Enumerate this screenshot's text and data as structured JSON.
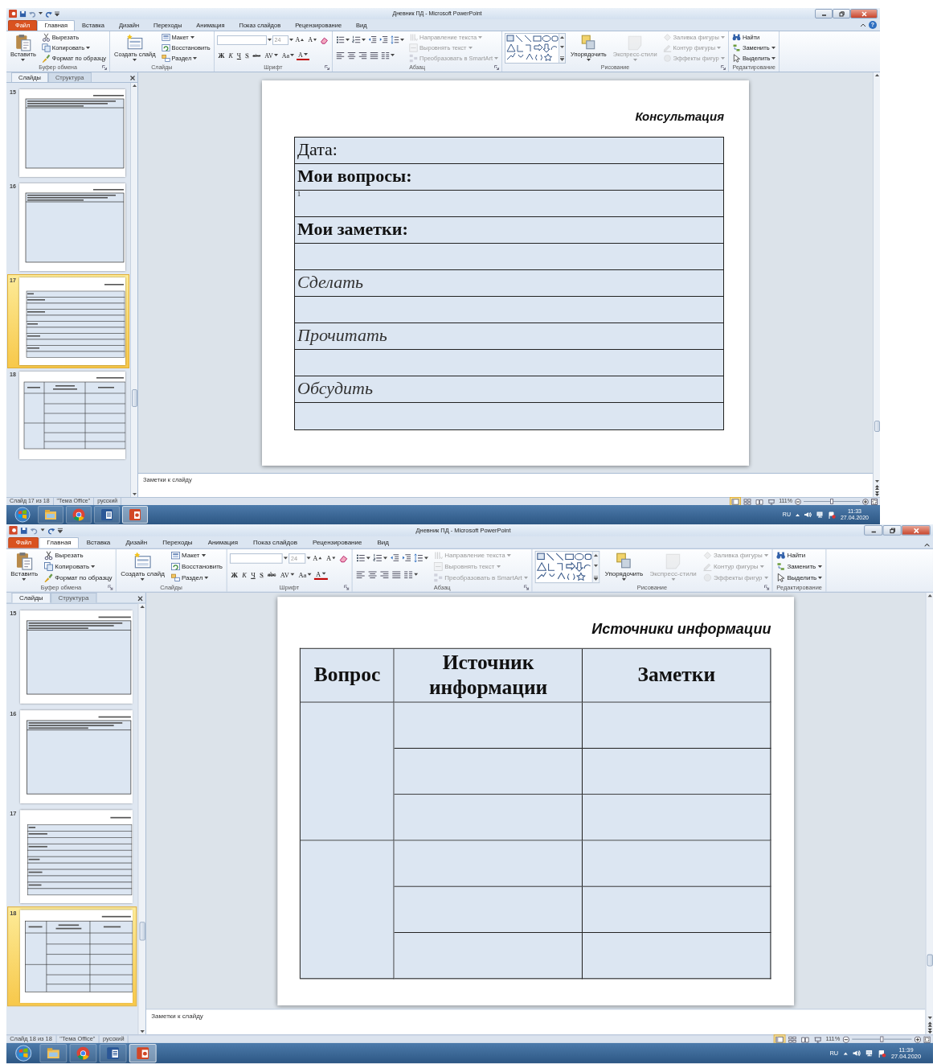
{
  "windows": [
    {
      "title": "Дневник ПД - Microsoft PowerPoint",
      "tabs": [
        {
          "label": "Файл",
          "kind": "file",
          "selected": false
        },
        {
          "label": "Главная",
          "kind": "tab",
          "selected": true
        },
        {
          "label": "Вставка",
          "kind": "tab",
          "selected": false
        },
        {
          "label": "Дизайн",
          "kind": "tab",
          "selected": false
        },
        {
          "label": "Переходы",
          "kind": "tab",
          "selected": false
        },
        {
          "label": "Анимация",
          "kind": "tab",
          "selected": false
        },
        {
          "label": "Показ слайдов",
          "kind": "tab",
          "selected": false
        },
        {
          "label": "Рецензирование",
          "kind": "tab",
          "selected": false
        },
        {
          "label": "Вид",
          "kind": "tab",
          "selected": false
        }
      ],
      "help": "?",
      "ribbon": [
        {
          "label": "Буфер обмена",
          "launcher": true,
          "columns": [
            [
              [
                {
                  "kind": "large",
                  "label": "Вставить",
                  "dropdown": true,
                  "disabled": false
                }
              ]
            ],
            [
              [
                {
                  "kind": "small",
                  "label": "Вырезать",
                  "dropdown": false,
                  "disabled": false
                }
              ],
              [
                {
                  "kind": "small",
                  "label": "Копировать",
                  "dropdown": true,
                  "disabled": false
                }
              ],
              [
                {
                  "kind": "small",
                  "label": "Формат по образцу",
                  "dropdown": false,
                  "disabled": false
                }
              ]
            ]
          ]
        },
        {
          "label": "Слайды",
          "launcher": false,
          "columns": [
            [
              [
                {
                  "kind": "large",
                  "label": "Создать слайд",
                  "dropdown": true,
                  "disabled": false
                }
              ]
            ],
            [
              [
                {
                  "kind": "small",
                  "label": "Макет",
                  "dropdown": true,
                  "disabled": false
                }
              ],
              [
                {
                  "kind": "small",
                  "label": "Восстановить",
                  "dropdown": false,
                  "disabled": false
                }
              ],
              [
                {
                  "kind": "small",
                  "label": "Раздел",
                  "dropdown": true,
                  "disabled": false
                }
              ]
            ]
          ]
        },
        {
          "label": "Шрифт",
          "launcher": true,
          "columns": [
            [
              [
                {
                  "kind": "fontname",
                  "dropdown": true,
                  "disabled": true
                },
                {
                  "kind": "fontsize",
                  "value": "24",
                  "dropdown": true,
                  "disabled": true
                },
                {
                  "kind": "glyph",
                  "text": "A",
                  "dropdown": false,
                  "disabled": false
                },
                {
                  "kind": "glyph",
                  "text": "A",
                  "dropdown": false,
                  "disabled": false
                },
                {
                  "kind": "tool",
                  "dropdown": false,
                  "disabled": false
                }
              ],
              [
                {
                  "kind": "glyph",
                  "text": "Ж",
                  "dropdown": false,
                  "disabled": false
                },
                {
                  "kind": "glyph",
                  "text": "К",
                  "dropdown": false,
                  "disabled": false
                },
                {
                  "kind": "glyph",
                  "text": "Ч",
                  "dropdown": false,
                  "disabled": false
                },
                {
                  "kind": "glyph",
                  "text": "S",
                  "dropdown": false,
                  "disabled": false
                },
                {
                  "kind": "glyph",
                  "text": "abc",
                  "dropdown": false,
                  "disabled": false
                },
                {
                  "kind": "glyph",
                  "text": "AV",
                  "dropdown": true,
                  "disabled": false
                },
                {
                  "kind": "glyph",
                  "text": "Aa",
                  "dropdown": true,
                  "disabled": false
                },
                {
                  "kind": "glyph",
                  "text": "A",
                  "dropdown": true,
                  "disabled": false
                }
              ]
            ]
          ]
        },
        {
          "label": "Абзац",
          "launcher": true,
          "columns": [
            [
              [
                {
                  "kind": "tool",
                  "dropdown": true,
                  "disabled": false
                },
                {
                  "kind": "tool",
                  "dropdown": true,
                  "disabled": false
                },
                {
                  "kind": "tool",
                  "dropdown": false,
                  "disabled": false
                },
                {
                  "kind": "tool",
                  "dropdown": false,
                  "disabled": false
                },
                {
                  "kind": "tool",
                  "dropdown": true,
                  "disabled": false
                }
              ],
              [
                {
                  "kind": "tool",
                  "dropdown": false,
                  "disabled": false
                },
                {
                  "kind": "tool",
                  "dropdown": false,
                  "disabled": false
                },
                {
                  "kind": "tool",
                  "dropdown": false,
                  "disabled": false
                },
                {
                  "kind": "tool",
                  "dropdown": false,
                  "disabled": false
                },
                {
                  "kind": "tool",
                  "dropdown": true,
                  "disabled": false
                }
              ]
            ],
            [
              [
                {
                  "kind": "small",
                  "label": "Направление текста",
                  "dropdown": true,
                  "disabled": true
                }
              ],
              [
                {
                  "kind": "small",
                  "label": "Выровнять текст",
                  "dropdown": true,
                  "disabled": true
                }
              ],
              [
                {
                  "kind": "small",
                  "label": "Преобразовать в SmartArt",
                  "dropdown": true,
                  "disabled": true
                }
              ]
            ]
          ]
        },
        {
          "label": "Рисование",
          "launcher": true,
          "columns": [
            [
              [
                {
                  "kind": "gallery",
                  "dropdown": true,
                  "disabled": false
                }
              ]
            ],
            [
              [
                {
                  "kind": "large",
                  "label": "Упорядочить",
                  "dropdown": true,
                  "disabled": false
                }
              ]
            ],
            [
              [
                {
                  "kind": "large",
                  "label": "Экспресс-стили",
                  "dropdown": true,
                  "disabled": true
                }
              ]
            ],
            [
              [
                {
                  "kind": "small",
                  "label": "Заливка фигуры",
                  "dropdown": true,
                  "disabled": true
                }
              ],
              [
                {
                  "kind": "small",
                  "label": "Контур фигуры",
                  "dropdown": true,
                  "disabled": true
                }
              ],
              [
                {
                  "kind": "small",
                  "label": "Эффекты фигур",
                  "dropdown": true,
                  "disabled": true
                }
              ]
            ]
          ]
        },
        {
          "label": "Редактирование",
          "launcher": false,
          "columns": [
            [
              [
                {
                  "kind": "small",
                  "label": "Найти",
                  "dropdown": false,
                  "disabled": false
                }
              ],
              [
                {
                  "kind": "small",
                  "label": "Заменить",
                  "dropdown": true,
                  "disabled": false
                }
              ],
              [
                {
                  "kind": "small",
                  "label": "Выделить",
                  "dropdown": true,
                  "disabled": false
                }
              ]
            ]
          ]
        }
      ],
      "pane_tabs": [
        {
          "label": "Слайды",
          "selected": true
        },
        {
          "label": "Структура",
          "selected": false
        }
      ],
      "thumbnails": [
        {
          "number": "15",
          "selected": false,
          "kind": "question"
        },
        {
          "number": "16",
          "selected": false,
          "kind": "question"
        },
        {
          "number": "17",
          "selected": true,
          "kind": "form"
        },
        {
          "number": "18",
          "selected": false,
          "kind": "grid"
        }
      ],
      "slide": {
        "kind": "form",
        "title": "Консультация",
        "rows": [
          {
            "text": "Дата:",
            "kind": "plain"
          },
          {
            "text": "Мои вопросы:",
            "kind": "bold"
          },
          {
            "text": "1",
            "kind": "note"
          },
          {
            "text": "Мои заметки:",
            "kind": "bold"
          },
          {
            "kind": "blank"
          },
          {
            "text": "Сделать",
            "kind": "italic"
          },
          {
            "kind": "blank"
          },
          {
            "text": "Прочитать",
            "kind": "italic"
          },
          {
            "kind": "blank"
          },
          {
            "text": "Обсудить",
            "kind": "italic"
          },
          {
            "kind": "blank"
          }
        ]
      },
      "notes": {
        "placeholder": "Заметки к слайду"
      },
      "status": [
        "Слайд 17 из 18",
        "\"Тема Office\"",
        "русский"
      ],
      "views": [
        {
          "selected": true
        },
        {
          "selected": false
        },
        {
          "selected": false
        },
        {
          "selected": false
        }
      ],
      "zoom": {
        "reading": "111%",
        "level": 0.5
      },
      "taskbar": {
        "apps": [
          {
            "kind": "folder",
            "selected": false
          },
          {
            "kind": "browser",
            "selected": false
          },
          {
            "kind": "writer",
            "selected": false
          },
          {
            "kind": "slides",
            "selected": true
          }
        ],
        "language": "RU",
        "time": "11:33",
        "date": "27.04.2020"
      }
    },
    {
      "title": "Дневник ПД - Microsoft PowerPoint",
      "tabs": [
        {
          "label": "Файл",
          "kind": "file",
          "selected": false
        },
        {
          "label": "Главная",
          "kind": "tab",
          "selected": true
        },
        {
          "label": "Вставка",
          "kind": "tab",
          "selected": false
        },
        {
          "label": "Дизайн",
          "kind": "tab",
          "selected": false
        },
        {
          "label": "Переходы",
          "kind": "tab",
          "selected": false
        },
        {
          "label": "Анимация",
          "kind": "tab",
          "selected": false
        },
        {
          "label": "Показ слайдов",
          "kind": "tab",
          "selected": false
        },
        {
          "label": "Рецензирование",
          "kind": "tab",
          "selected": false
        },
        {
          "label": "Вид",
          "kind": "tab",
          "selected": false
        }
      ],
      "ribbon": [
        {
          "label": "Буфер обмена",
          "launcher": true,
          "columns": [
            [
              [
                {
                  "kind": "large",
                  "label": "Вставить",
                  "dropdown": true,
                  "disabled": false
                }
              ]
            ],
            [
              [
                {
                  "kind": "small",
                  "label": "Вырезать",
                  "dropdown": false,
                  "disabled": false
                }
              ],
              [
                {
                  "kind": "small",
                  "label": "Копировать",
                  "dropdown": true,
                  "disabled": false
                }
              ],
              [
                {
                  "kind": "small",
                  "label": "Формат по образцу",
                  "dropdown": false,
                  "disabled": false
                }
              ]
            ]
          ]
        },
        {
          "label": "Слайды",
          "launcher": false,
          "columns": [
            [
              [
                {
                  "kind": "large",
                  "label": "Создать слайд",
                  "dropdown": true,
                  "disabled": false
                }
              ]
            ],
            [
              [
                {
                  "kind": "small",
                  "label": "Макет",
                  "dropdown": true,
                  "disabled": false
                }
              ],
              [
                {
                  "kind": "small",
                  "label": "Восстановить",
                  "dropdown": false,
                  "disabled": false
                }
              ],
              [
                {
                  "kind": "small",
                  "label": "Раздел",
                  "dropdown": true,
                  "disabled": false
                }
              ]
            ]
          ]
        },
        {
          "label": "Шрифт",
          "launcher": true,
          "columns": [
            [
              [
                {
                  "kind": "fontname",
                  "dropdown": true,
                  "disabled": true
                },
                {
                  "kind": "fontsize",
                  "value": "24",
                  "dropdown": true,
                  "disabled": true
                },
                {
                  "kind": "glyph",
                  "text": "A",
                  "dropdown": false,
                  "disabled": false
                },
                {
                  "kind": "glyph",
                  "text": "A",
                  "dropdown": false,
                  "disabled": false
                },
                {
                  "kind": "tool",
                  "dropdown": false,
                  "disabled": false
                }
              ],
              [
                {
                  "kind": "glyph",
                  "text": "Ж",
                  "dropdown": false,
                  "disabled": false
                },
                {
                  "kind": "glyph",
                  "text": "К",
                  "dropdown": false,
                  "disabled": false
                },
                {
                  "kind": "glyph",
                  "text": "Ч",
                  "dropdown": false,
                  "disabled": false
                },
                {
                  "kind": "glyph",
                  "text": "S",
                  "dropdown": false,
                  "disabled": false
                },
                {
                  "kind": "glyph",
                  "text": "abc",
                  "dropdown": false,
                  "disabled": false
                },
                {
                  "kind": "glyph",
                  "text": "AV",
                  "dropdown": true,
                  "disabled": false
                },
                {
                  "kind": "glyph",
                  "text": "Aa",
                  "dropdown": true,
                  "disabled": false
                },
                {
                  "kind": "glyph",
                  "text": "A",
                  "dropdown": true,
                  "disabled": false
                }
              ]
            ]
          ]
        },
        {
          "label": "Абзац",
          "launcher": true,
          "columns": [
            [
              [
                {
                  "kind": "tool",
                  "dropdown": true,
                  "disabled": false
                },
                {
                  "kind": "tool",
                  "dropdown": true,
                  "disabled": false
                },
                {
                  "kind": "tool",
                  "dropdown": false,
                  "disabled": false
                },
                {
                  "kind": "tool",
                  "dropdown": false,
                  "disabled": false
                },
                {
                  "kind": "tool",
                  "dropdown": true,
                  "disabled": false
                }
              ],
              [
                {
                  "kind": "tool",
                  "dropdown": false,
                  "disabled": false
                },
                {
                  "kind": "tool",
                  "dropdown": false,
                  "disabled": false
                },
                {
                  "kind": "tool",
                  "dropdown": false,
                  "disabled": false
                },
                {
                  "kind": "tool",
                  "dropdown": false,
                  "disabled": false
                },
                {
                  "kind": "tool",
                  "dropdown": true,
                  "disabled": false
                }
              ]
            ],
            [
              [
                {
                  "kind": "small",
                  "label": "Направление текста",
                  "dropdown": true,
                  "disabled": true
                }
              ],
              [
                {
                  "kind": "small",
                  "label": "Выровнять текст",
                  "dropdown": true,
                  "disabled": true
                }
              ],
              [
                {
                  "kind": "small",
                  "label": "Преобразовать в SmartArt",
                  "dropdown": true,
                  "disabled": true
                }
              ]
            ]
          ]
        },
        {
          "label": "Рисование",
          "launcher": true,
          "columns": [
            [
              [
                {
                  "kind": "gallery",
                  "dropdown": true,
                  "disabled": false
                }
              ]
            ],
            [
              [
                {
                  "kind": "large",
                  "label": "Упорядочить",
                  "dropdown": true,
                  "disabled": false
                }
              ]
            ],
            [
              [
                {
                  "kind": "large",
                  "label": "Экспресс-стили",
                  "dropdown": true,
                  "disabled": true
                }
              ]
            ],
            [
              [
                {
                  "kind": "small",
                  "label": "Заливка фигуры",
                  "dropdown": true,
                  "disabled": true
                }
              ],
              [
                {
                  "kind": "small",
                  "label": "Контур фигуры",
                  "dropdown": true,
                  "disabled": true
                }
              ],
              [
                {
                  "kind": "small",
                  "label": "Эффекты фигур",
                  "dropdown": true,
                  "disabled": true
                }
              ]
            ]
          ]
        },
        {
          "label": "Редактирование",
          "launcher": false,
          "columns": [
            [
              [
                {
                  "kind": "small",
                  "label": "Найти",
                  "dropdown": false,
                  "disabled": false
                }
              ],
              [
                {
                  "kind": "small",
                  "label": "Заменить",
                  "dropdown": true,
                  "disabled": false
                }
              ],
              [
                {
                  "kind": "small",
                  "label": "Выделить",
                  "dropdown": true,
                  "disabled": false
                }
              ]
            ]
          ]
        }
      ],
      "pane_tabs": [
        {
          "label": "Слайды",
          "selected": true
        },
        {
          "label": "Структура",
          "selected": false
        }
      ],
      "thumbnails": [
        {
          "number": "15",
          "selected": false,
          "kind": "question"
        },
        {
          "number": "16",
          "selected": false,
          "kind": "question"
        },
        {
          "number": "17",
          "selected": false,
          "kind": "form"
        },
        {
          "number": "18",
          "selected": true,
          "kind": "grid"
        }
      ],
      "slide": {
        "kind": "grid",
        "title": "Источники информации",
        "columns": [
          "Вопрос",
          "Источник информации",
          "Заметки"
        ],
        "row_groups": [
          [
            {
              "kind": "blank"
            },
            {
              "kind": "blank"
            },
            {
              "kind": "blank"
            }
          ],
          [
            {
              "kind": "blank"
            },
            {
              "kind": "blank"
            },
            {
              "kind": "blank"
            }
          ]
        ]
      },
      "notes": {
        "placeholder": "Заметки к слайду"
      },
      "status": [
        "Слайд 18 из 18",
        "\"Тема Office\"",
        "русский"
      ],
      "views": [
        {
          "selected": true
        },
        {
          "selected": false
        },
        {
          "selected": false
        },
        {
          "selected": false
        }
      ],
      "zoom": {
        "reading": "111%",
        "level": 0.5
      },
      "taskbar": {
        "apps": [
          {
            "kind": "folder",
            "selected": false
          },
          {
            "kind": "browser",
            "selected": false
          },
          {
            "kind": "writer",
            "selected": false
          },
          {
            "kind": "slides",
            "selected": true
          }
        ],
        "language": "RU",
        "time": "11:39",
        "date": "27.04.2020"
      }
    }
  ]
}
